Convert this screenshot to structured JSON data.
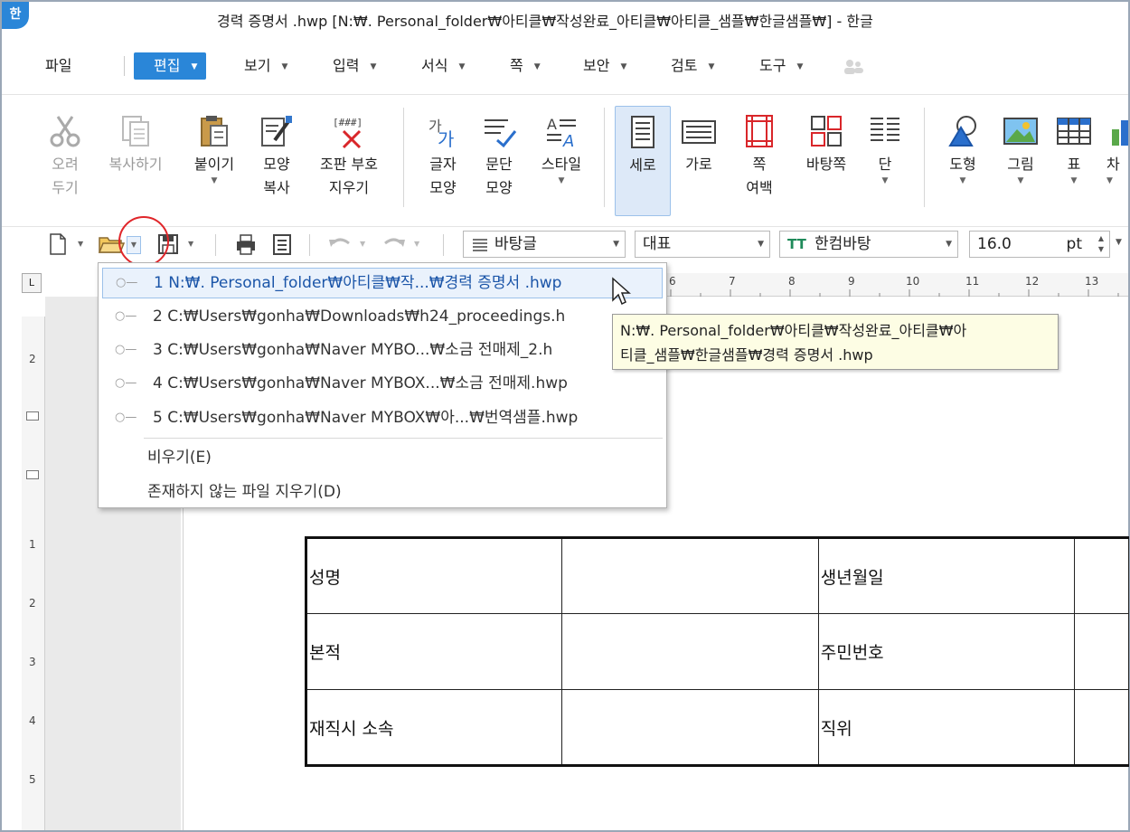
{
  "app": {
    "logo": "한",
    "title": "경력 증명서 .hwp [N:₩. Personal_folder₩아티클₩작성완료_아티클₩아티클_샘플₩한글샘플₩] - 한글"
  },
  "menu": {
    "items": [
      "파일",
      "편집",
      "보기",
      "입력",
      "서식",
      "쪽",
      "보안",
      "검토",
      "도구"
    ],
    "active": "편집"
  },
  "ribbon": {
    "cut": "오려\n두기",
    "copy": "복사하기",
    "paste": "붙이기",
    "format_copy": "모양\n복사",
    "clear_marks": "조판 부호\n지우기",
    "char_shape": "글자\n모양",
    "para_shape": "문단\n모양",
    "style": "스타일",
    "portrait": "세로",
    "landscape": "가로",
    "page_margin": "쪽\n여백",
    "master_page": "바탕쪽",
    "columns": "단",
    "shape": "도형",
    "picture": "그림",
    "table": "표",
    "chart": "차"
  },
  "toolbar": {
    "style_combo": "바탕글",
    "lang_combo": "대표",
    "font_combo": "한컴바탕",
    "size_value": "16.0",
    "size_unit": "pt"
  },
  "recent_files": {
    "items": [
      "1 N:₩. Personal_folder₩아티클₩작...₩경력 증명서 .hwp",
      "2 C:₩Users₩gonha₩Downloads₩h24_proceedings.h",
      "3 C:₩Users₩gonha₩Naver MYBO...₩소금 전매제_2.h",
      "4 C:₩Users₩gonha₩Naver MYBOX...₩소금 전매제.hwp",
      "5 C:₩Users₩gonha₩Naver MYBOX₩아...₩번역샘플.hwp"
    ],
    "clear": "비우기(E)",
    "remove_missing": "존재하지 않는 파일 지우기(D)"
  },
  "tooltip": {
    "line1": "N:₩. Personal_folder₩아티클₩작성완료_아티클₩아",
    "line2": "티클_샘플₩한글샘플₩경력 증명서 .hwp"
  },
  "ruler": {
    "h_ticks": [
      "6",
      "7",
      "8",
      "9",
      "10",
      "11",
      "12",
      "13"
    ],
    "v_ticks": [
      "2",
      "1",
      "2",
      "3",
      "4",
      "5"
    ]
  },
  "document": {
    "rows": [
      [
        "성명",
        "",
        "생년월일",
        ""
      ],
      [
        "본적",
        "",
        "주민번호",
        ""
      ],
      [
        "재직시  소속",
        "",
        "직위",
        ""
      ]
    ]
  }
}
